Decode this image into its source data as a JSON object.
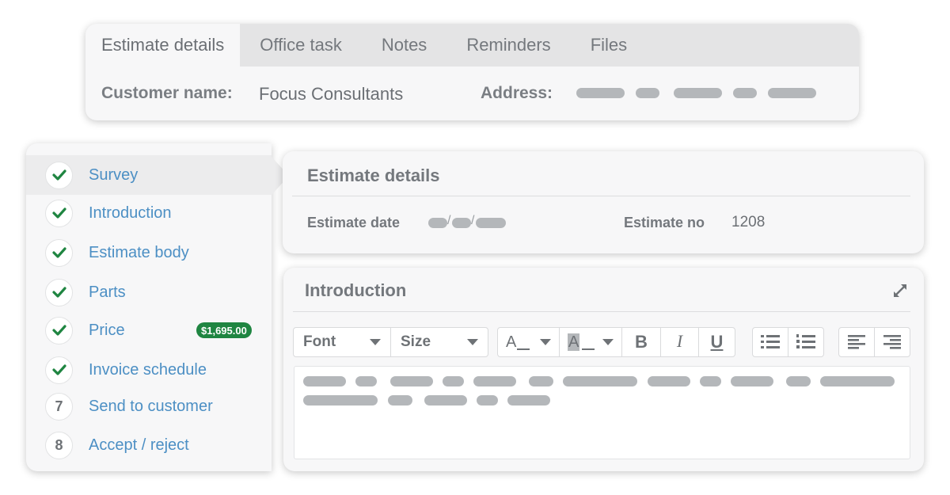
{
  "tabs": [
    {
      "label": "Estimate details",
      "active": true
    },
    {
      "label": "Office task"
    },
    {
      "label": "Notes"
    },
    {
      "label": "Reminders"
    },
    {
      "label": "Files"
    }
  ],
  "customer": {
    "name_label": "Customer name:",
    "name_value": "Focus Consultants",
    "address_label": "Address:"
  },
  "steps": [
    {
      "label": "Survey",
      "status": "done",
      "active": true
    },
    {
      "label": "Introduction",
      "status": "done"
    },
    {
      "label": "Estimate body",
      "status": "done"
    },
    {
      "label": "Parts",
      "status": "done"
    },
    {
      "label": "Price",
      "status": "done",
      "badge": "$1,695.00"
    },
    {
      "label": "Invoice schedule",
      "status": "done"
    },
    {
      "label": "Send to customer",
      "status": "pending",
      "number": "7"
    },
    {
      "label": "Accept / reject",
      "status": "pending",
      "number": "8"
    }
  ],
  "estimate_details": {
    "title": "Estimate details",
    "date_label": "Estimate date",
    "date_separator": "/",
    "no_label": "Estimate no",
    "no_value": "1208"
  },
  "introduction": {
    "title": "Introduction",
    "font_select": "Font",
    "size_select": "Size",
    "font_color_glyph": "A",
    "highlight_glyph": "A",
    "bold_glyph": "B",
    "italic_glyph": "I",
    "underline_glyph": "U"
  },
  "colors": {
    "accent_link": "#4c8fc4",
    "check_green": "#1f8541",
    "badge_green": "#1f8541",
    "placeholder_gray": "#b4b7ba"
  },
  "icons": {
    "check": "check-icon",
    "expand": "expand-icon",
    "bullet_list": "bullet-list-icon",
    "numbered_list": "numbered-list-icon",
    "align_left": "align-left-icon",
    "align_right": "align-right-icon"
  }
}
